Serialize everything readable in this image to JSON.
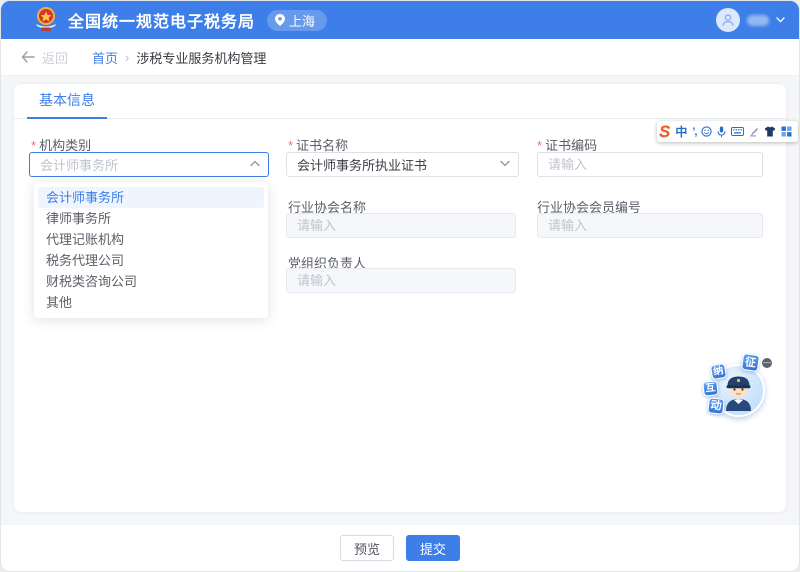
{
  "header": {
    "title": "全国统一规范电子税务局",
    "location": "上海"
  },
  "breadcrumb": {
    "back": "返回",
    "home": "首页",
    "separator": "›",
    "current": "涉税专业服务机构管理"
  },
  "tab": {
    "basic_info": "基本信息"
  },
  "form": {
    "required_marker": "*",
    "org_type": {
      "label": "机构类别",
      "value": "会计师事务所"
    },
    "cert_name": {
      "label": "证书名称",
      "value": "会计师事务所执业证书"
    },
    "cert_code": {
      "label": "证书编码",
      "placeholder": "请输入"
    },
    "assoc_name": {
      "label": "行业协会名称",
      "placeholder": "请输入"
    },
    "assoc_member_no": {
      "label": "行业协会会员编号",
      "placeholder": "请输入"
    },
    "party_leader": {
      "label": "党组织负责人",
      "placeholder": "请输入"
    },
    "dropdown_options": [
      "会计师事务所",
      "律师事务所",
      "代理记账机构",
      "税务代理公司",
      "财税类咨询公司",
      "其他"
    ],
    "dropdown_selected": "会计师事务所"
  },
  "ime": {
    "logo": "S",
    "mode": "中",
    "punct": "’,"
  },
  "mascot": {
    "chars": [
      "征",
      "纳",
      "互",
      "动"
    ],
    "close": "—"
  },
  "footer": {
    "preview": "预览",
    "submit": "提交"
  },
  "colors": {
    "primary": "#3D7EE8",
    "header_bg": "#3D7EE8",
    "required_red": "#F56C6C",
    "placeholder_gray": "#C0C4CC",
    "disabled_bg": "#F5F7FA",
    "option_active_bg": "#EEF5FF",
    "ime_logo_orange": "#F15A22"
  }
}
